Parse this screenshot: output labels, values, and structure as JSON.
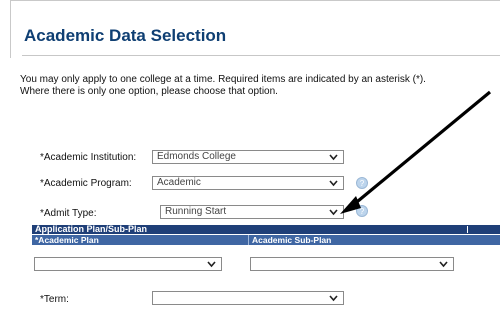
{
  "page": {
    "title": "Academic Data Selection",
    "intro_line1": "You may only apply to one college at a time. Required items are indicated by an asterisk (*).",
    "intro_line2": "Where there is only one option, please choose that option."
  },
  "fields": {
    "institution": {
      "label": "*Academic Institution:",
      "value": "Edmonds College"
    },
    "program": {
      "label": "*Academic Program:",
      "value": "Academic"
    },
    "admit_type": {
      "label": "*Admit Type:",
      "value": "Running Start"
    },
    "term": {
      "label": "*Term:",
      "value": ""
    }
  },
  "plan_section": {
    "header": "Application Plan/Sub-Plan",
    "col_plan": "*Academic Plan",
    "col_subplan": "Academic Sub-Plan",
    "plan_value": "",
    "subplan_value": ""
  },
  "help_icon": {
    "glyph": "?"
  },
  "colors": {
    "title": "#0f3f73",
    "header_bg": "#1f3f78",
    "subheader_bg": "#3f66a3",
    "help_icon": "#bcd4ec"
  },
  "icons": [
    "chevron-down-icon",
    "help-icon",
    "annotation-arrow"
  ]
}
